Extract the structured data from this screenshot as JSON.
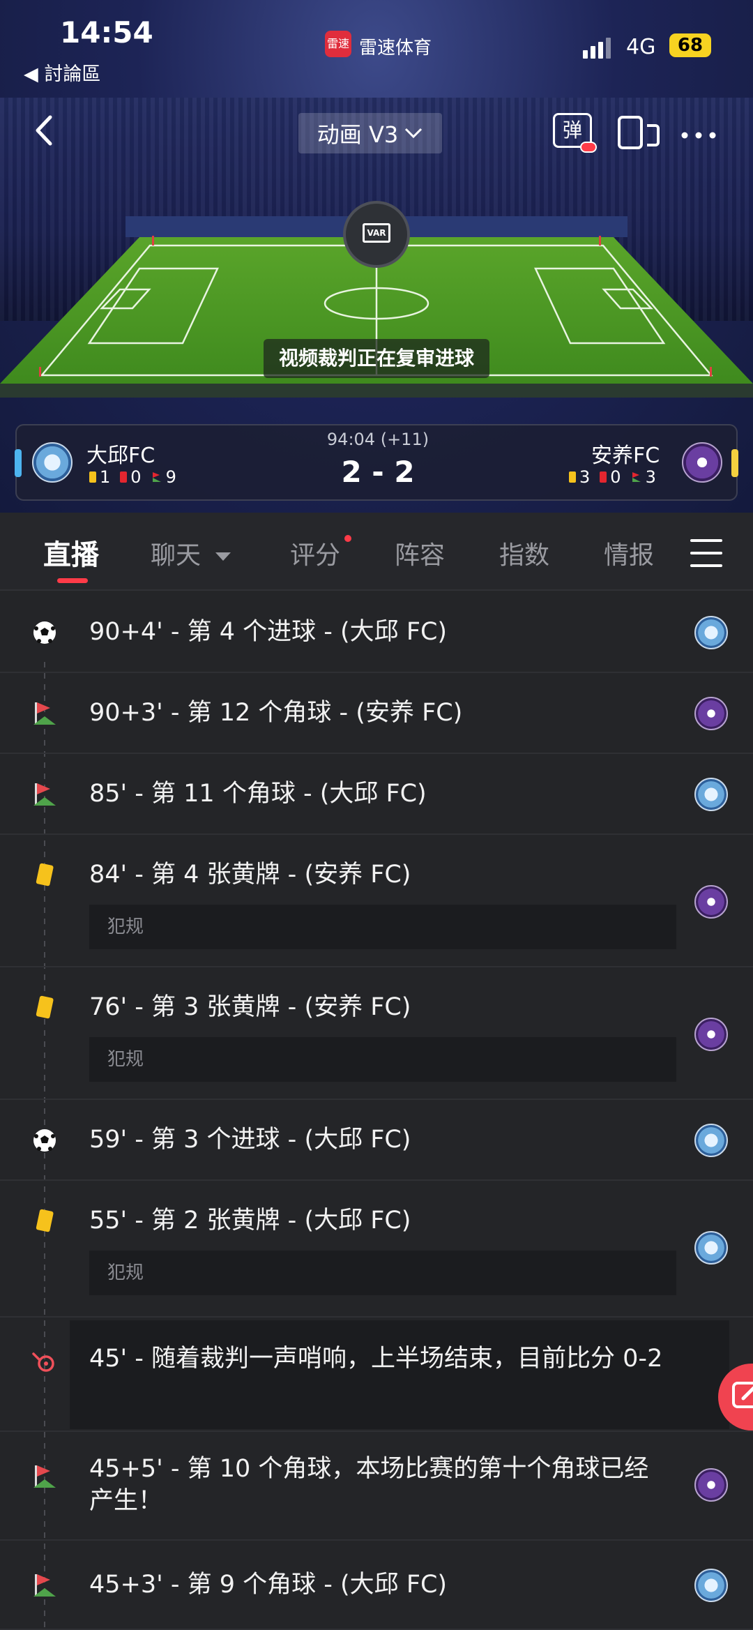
{
  "status": {
    "time": "14:54",
    "back_app": "◀ 討論區",
    "app_logo": "雷速",
    "app_name": "雷速体育",
    "network": "4G",
    "battery": "68"
  },
  "nav": {
    "animation_select": "动画 V3",
    "danmu_label": "弹"
  },
  "pitch": {
    "var_label": "VAR",
    "var_message": "视频裁判正在复审进球"
  },
  "match": {
    "home": {
      "name": "大邱FC",
      "yellow": "1",
      "red": "0",
      "corners": "9"
    },
    "away": {
      "name": "安养FC",
      "yellow": "3",
      "red": "0",
      "corners": "3"
    },
    "time": "94:04 (+11)",
    "score": "2 - 2"
  },
  "tabs": [
    {
      "label": "直播",
      "active": true
    },
    {
      "label": "聊天",
      "has_dropdown": true
    },
    {
      "label": "评分",
      "has_dot": true
    },
    {
      "label": "阵容"
    },
    {
      "label": "指数"
    },
    {
      "label": "情报"
    }
  ],
  "events": [
    {
      "icon": "soccer-ball-icon",
      "text": "90+4' - 第 4 个进球 - (大邱 FC)",
      "team": "daegu"
    },
    {
      "icon": "corner-flag-icon",
      "text": "90+3' - 第 12 个角球 - (安养 FC)",
      "team": "anyang"
    },
    {
      "icon": "corner-flag-icon",
      "text": "85' - 第 11 个角球 - (大邱 FC)",
      "team": "daegu"
    },
    {
      "icon": "yellow-card-icon",
      "text": "84' - 第 4 张黄牌 - (安养 FC)",
      "detail": "犯规",
      "team": "anyang"
    },
    {
      "icon": "yellow-card-icon",
      "text": "76' - 第 3 张黄牌 - (安养 FC)",
      "detail": "犯规",
      "team": "anyang"
    },
    {
      "icon": "soccer-ball-icon",
      "text": "59' - 第 3 个进球 - (大邱 FC)",
      "team": "daegu"
    },
    {
      "icon": "yellow-card-icon",
      "text": "55' - 第 2 张黄牌 - (大邱 FC)",
      "detail": "犯规",
      "team": "daegu"
    },
    {
      "icon": "whistle-icon",
      "text": "45' - 随着裁判一声哨响，上半场结束，目前比分 0-2"
    },
    {
      "icon": "corner-flag-icon",
      "text": "45+5' - 第 10 个角球，本场比赛的第十个角球已经产生！",
      "team": "anyang"
    },
    {
      "icon": "corner-flag-icon",
      "text": "45+3' - 第 9 个角球 - (大邱 FC)",
      "team": "daegu"
    }
  ],
  "colors": {
    "accent": "#ff3b48",
    "home_side": "#4db4f0",
    "away_side": "#f4d03f",
    "background": "#242528"
  }
}
